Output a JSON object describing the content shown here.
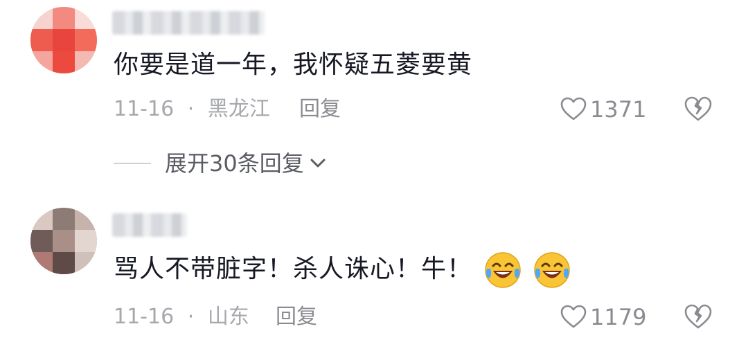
{
  "comments": [
    {
      "text": "你要是道一年，我怀疑五菱要黄",
      "date": "11-16",
      "separator": "·",
      "location": "黑龙江",
      "reply_label": "回复",
      "likes": "1371",
      "expand_label": "展开30条回复",
      "avatar_colors": [
        "#e8453c",
        "#f26b5b",
        "#d93a32"
      ]
    },
    {
      "text": "骂人不带脏字！杀人诛心！牛！",
      "emoji": [
        "laughing-crying-emoji",
        "laughing-crying-emoji"
      ],
      "date": "11-16",
      "separator": "·",
      "location": "山东",
      "reply_label": "回复",
      "likes": "1179",
      "avatar_colors": [
        "#8a7470",
        "#c9b5ae",
        "#5e4a46"
      ]
    }
  ]
}
